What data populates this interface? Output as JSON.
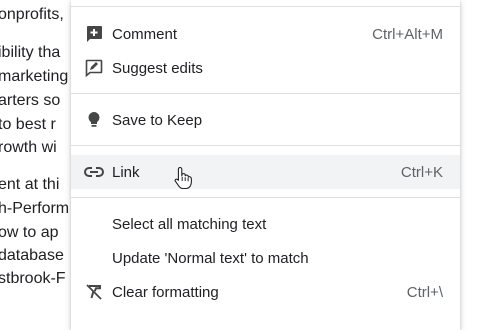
{
  "document": {
    "lines": [
      "onprofits,",
      "ibility tha",
      "marketing",
      "arters so",
      "to best r",
      "rowth wi",
      "ent at thi",
      "h-Perform",
      "ow to ap",
      "database",
      "stbrook-F"
    ]
  },
  "menu": {
    "items": [
      {
        "label": "Comment",
        "shortcut": "Ctrl+Alt+M",
        "icon": "add-comment-icon"
      },
      {
        "label": "Suggest edits",
        "shortcut": "",
        "icon": "suggest-edits-icon"
      },
      {
        "label": "Save to Keep",
        "shortcut": "",
        "icon": "keep-bulb-icon"
      },
      {
        "label": "Link",
        "shortcut": "Ctrl+K",
        "icon": "link-icon"
      },
      {
        "label": "Select all matching text",
        "shortcut": "",
        "icon": ""
      },
      {
        "label": "Update 'Normal text' to match",
        "shortcut": "",
        "icon": ""
      },
      {
        "label": "Clear formatting",
        "shortcut": "Ctrl+\\",
        "icon": "clear-formatting-icon"
      }
    ]
  }
}
